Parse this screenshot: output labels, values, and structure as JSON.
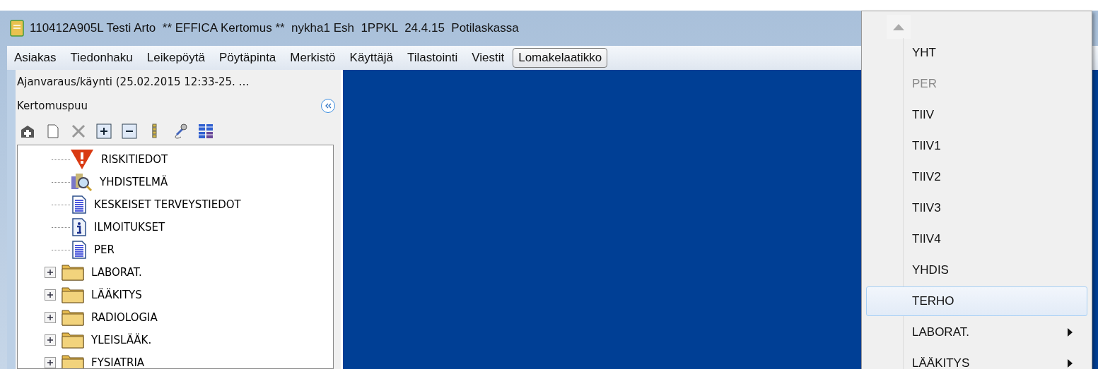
{
  "window": {
    "title": "110412A905L Testi Arto  ** EFFICA Kertomus **  nykha1 Esh  1PPKL  24.4.15  Potilaskassa"
  },
  "menu_bar": [
    {
      "label": "Asiakas",
      "selected": false
    },
    {
      "label": "Tiedonhaku",
      "selected": false
    },
    {
      "label": "Leikepöytä",
      "selected": false
    },
    {
      "label": "Pöytäpinta",
      "selected": false
    },
    {
      "label": "Merkistö",
      "selected": false
    },
    {
      "label": "Käyttäjä",
      "selected": false
    },
    {
      "label": "Tilastointi",
      "selected": false
    },
    {
      "label": "Viestit",
      "selected": false
    },
    {
      "label": "Lomakelaatikko",
      "selected": true
    }
  ],
  "sidebar": {
    "visit": "Ajanvaraus/käynti (25.02.2015 12:33-25. …",
    "title": "Kertomuspuu",
    "tree": [
      {
        "label": "RISKITIEDOT",
        "kind": "warning",
        "expandable": false
      },
      {
        "label": "YHDISTELMÄ",
        "kind": "search",
        "expandable": false
      },
      {
        "label": "KESKEISET TERVEYSTIEDOT",
        "kind": "document",
        "expandable": false
      },
      {
        "label": "ILMOITUKSET",
        "kind": "info",
        "expandable": false
      },
      {
        "label": "PER",
        "kind": "document",
        "expandable": false
      },
      {
        "label": "LABORAT.",
        "kind": "folder",
        "expandable": true
      },
      {
        "label": "LÄÄKITYS",
        "kind": "folder",
        "expandable": true
      },
      {
        "label": "RADIOLOGIA",
        "kind": "folder",
        "expandable": true
      },
      {
        "label": "YLEISLÄÄK.",
        "kind": "folder",
        "expandable": true
      },
      {
        "label": "FYSIATRIA",
        "kind": "folder",
        "expandable": true
      }
    ]
  },
  "dropdown": [
    {
      "label": "YHT",
      "disabled": false,
      "submenu": false,
      "selected": false
    },
    {
      "label": "PER",
      "disabled": true,
      "submenu": false,
      "selected": false
    },
    {
      "label": "TIIV",
      "disabled": false,
      "submenu": false,
      "selected": false
    },
    {
      "label": "TIIV1",
      "disabled": false,
      "submenu": false,
      "selected": false
    },
    {
      "label": "TIIV2",
      "disabled": false,
      "submenu": false,
      "selected": false
    },
    {
      "label": "TIIV3",
      "disabled": false,
      "submenu": false,
      "selected": false
    },
    {
      "label": "TIIV4",
      "disabled": false,
      "submenu": false,
      "selected": false
    },
    {
      "label": "YHDIS",
      "disabled": false,
      "submenu": false,
      "selected": false
    },
    {
      "label": "TERHO",
      "disabled": false,
      "submenu": false,
      "selected": true
    },
    {
      "label": "LABORAT.",
      "disabled": false,
      "submenu": true,
      "selected": false
    },
    {
      "label": "LÄÄKITYS",
      "disabled": false,
      "submenu": true,
      "selected": false
    }
  ]
}
